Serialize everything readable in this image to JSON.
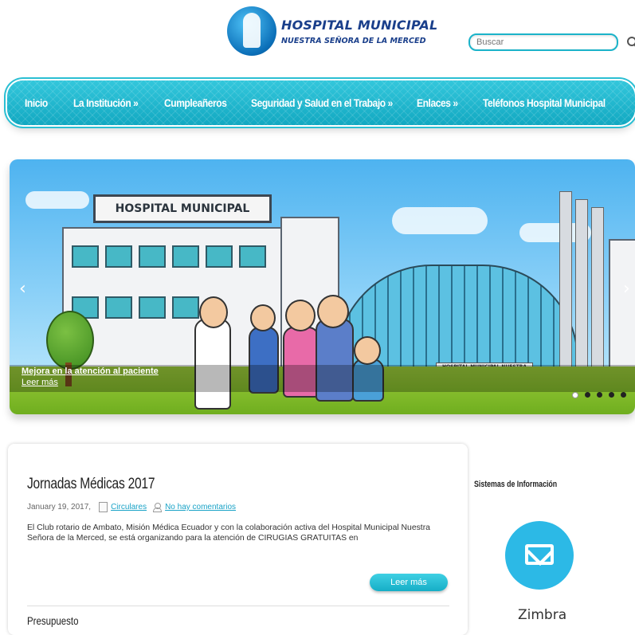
{
  "header": {
    "logo_title": "HOSPITAL MUNICIPAL",
    "logo_subtitle": "NUESTRA SEÑORA DE LA MERCED",
    "search_placeholder": "Buscar"
  },
  "nav": {
    "items": [
      {
        "label": "Inicio"
      },
      {
        "label": "La Institución »"
      },
      {
        "label": "Cumpleañeros"
      },
      {
        "label": "Seguridad y Salud en el Trabajo »"
      },
      {
        "label": "Enlaces »"
      },
      {
        "label": "Teléfonos Hospital Municipal"
      }
    ]
  },
  "slider": {
    "image_sign": "HOSPITAL MUNICIPAL",
    "glass_sign": "HOSPITAL MUNICIPAL NUESTRA SEÑORA DE LA MERCED",
    "caption_title": "Mejora en la atención al paciente",
    "caption_link": "Leer más",
    "prev_icon": "‹",
    "next_icon": "›",
    "dots": 5,
    "active_dot": 0
  },
  "post": {
    "title": "Jornadas Médicas 2017",
    "date": "January 19, 2017,",
    "category": "Circulares",
    "comments": "No hay comentarios",
    "excerpt": "El Club rotario de Ambato, Misión Médica Ecuador y con la colaboración activa del Hospital Municipal Nuestra Señora de la Merced, se está organizando para la atención de CIRUGIAS GRATUITAS en",
    "read_more": "Leer más",
    "next_title": "Presupuesto"
  },
  "sidebar": {
    "title": "Sistemas de Información",
    "zimbra_label": "Zimbra"
  },
  "colors": {
    "accent": "#1bb3c9",
    "brand": "#1a3f8b"
  }
}
